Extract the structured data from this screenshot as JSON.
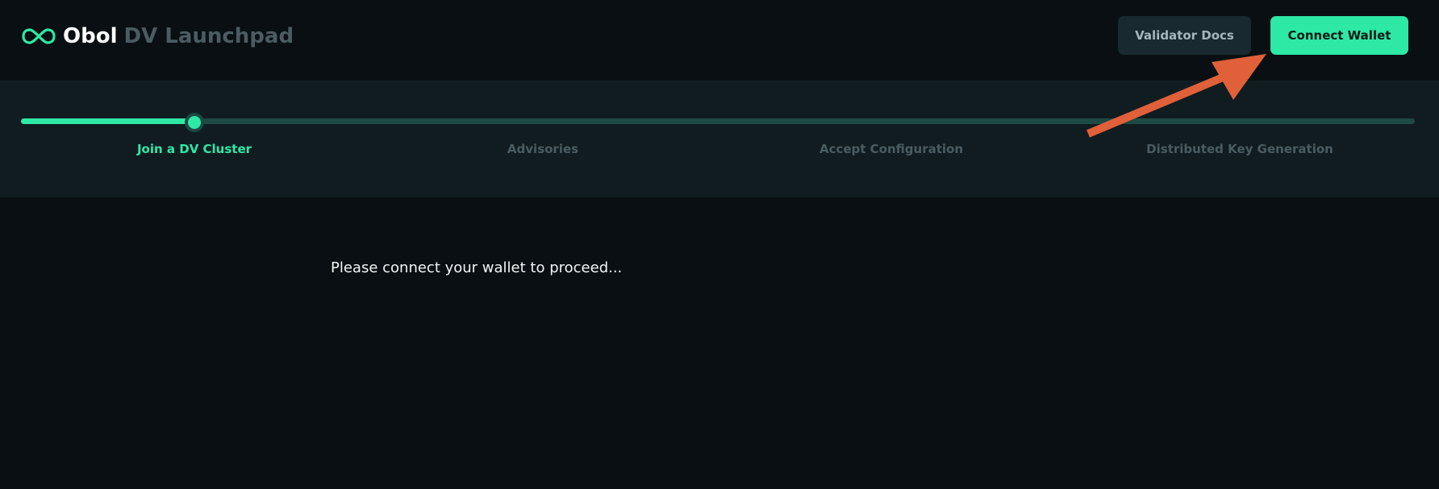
{
  "header": {
    "logo_name": "Obol",
    "product_name": "DV Launchpad",
    "docs_button_label": "Validator Docs",
    "connect_button_label": "Connect Wallet"
  },
  "stepper": {
    "progress": 0.125,
    "steps": [
      {
        "label": "Join a DV Cluster",
        "active": true
      },
      {
        "label": "Advisories",
        "active": false
      },
      {
        "label": "Accept Configuration",
        "active": false
      },
      {
        "label": "Distributed Key Generation",
        "active": false
      }
    ]
  },
  "main": {
    "message": "Please connect your wallet to proceed..."
  },
  "colors": {
    "accent": "#2ee8a6",
    "background": "#090f12",
    "stepper_band": "#111c21",
    "annotation_arrow": "#e0603a"
  },
  "icons": {
    "logo": "infinity-icon"
  }
}
